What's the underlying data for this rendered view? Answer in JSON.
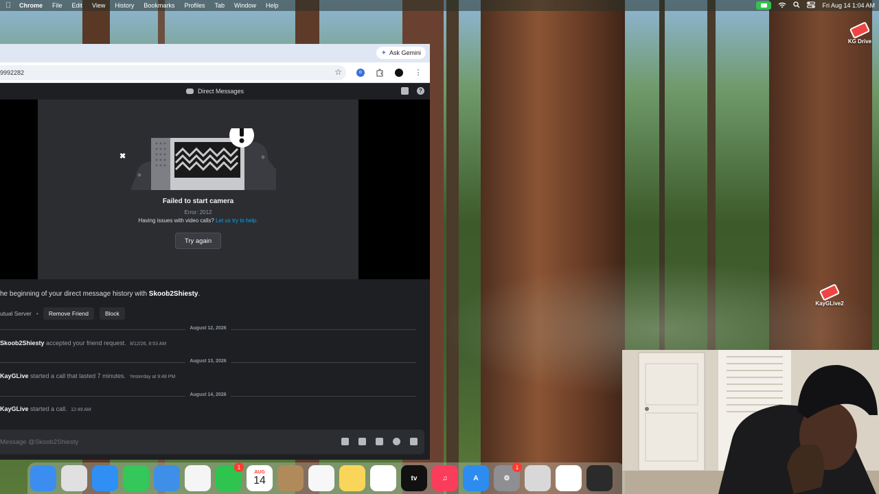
{
  "menubar": {
    "app_name": "Chrome",
    "items": [
      "File",
      "Edit",
      "View",
      "History",
      "Bookmarks",
      "Profiles",
      "Tab",
      "Window",
      "Help"
    ],
    "clock": "Fri Aug 14  1:04 AM"
  },
  "desktop": {
    "icons": [
      {
        "label": "KG Drive",
        "icon": "drive-icon"
      },
      {
        "label": "KayGLive2",
        "icon": "drive-icon"
      }
    ]
  },
  "browser": {
    "ask_gemini_label": "Ask Gemini",
    "url_text": "9992282"
  },
  "discord": {
    "header_title": "Direct Messages",
    "call": {
      "title": "Failed to start camera",
      "error": "Error: 2012",
      "help_text": "Having issues with video calls?",
      "help_link": "Let us try to help.",
      "try_again_label": "Try again"
    },
    "history": {
      "beginning_prefix": "he beginning of your direct message history with",
      "username": "Skoob2Shiesty",
      "mutual_server": "utual Server",
      "remove_friend_label": "Remove Friend",
      "block_label": "Block"
    },
    "messages": [
      {
        "date": "August 12, 2026",
        "author": "Skoob2Shiesty",
        "text": "accepted your friend request.",
        "time": "8/12/26, 8:53 AM"
      },
      {
        "date": "August 13, 2026",
        "author": "KayGLive",
        "text": "started a call that lasted 7 minutes.",
        "time": "Yesterday at 9:48 PM"
      },
      {
        "date": "August 14, 2026",
        "author": "KayGLive",
        "text": "started a call.",
        "time": "12:49 AM"
      }
    ],
    "composer_placeholder": "Message @Skoob2Shiesty"
  },
  "dock": {
    "apps": [
      {
        "name": "finder",
        "color": "#3b8ef0",
        "label": ""
      },
      {
        "name": "launchpad",
        "color": "#e0e0e0",
        "label": ""
      },
      {
        "name": "safari",
        "color": "#2f8ff5",
        "label": ""
      },
      {
        "name": "messages",
        "color": "#34c759",
        "label": ""
      },
      {
        "name": "mail",
        "color": "#3d8fe8",
        "label": ""
      },
      {
        "name": "photos",
        "color": "#f5f5f5",
        "label": ""
      },
      {
        "name": "facetime",
        "color": "#2ec44f",
        "label": "",
        "badge": "1"
      },
      {
        "name": "calendar",
        "color": "#ffffff",
        "label": "14",
        "top": "AUG"
      },
      {
        "name": "contacts",
        "color": "#b08a5a",
        "label": ""
      },
      {
        "name": "reminders",
        "color": "#f7f7f7",
        "label": ""
      },
      {
        "name": "notes",
        "color": "#f9d65a",
        "label": ""
      },
      {
        "name": "freeform",
        "color": "#ffffff",
        "label": ""
      },
      {
        "name": "tv",
        "color": "#111111",
        "label": "tv"
      },
      {
        "name": "music",
        "color": "#fa3d5a",
        "label": "♫"
      },
      {
        "name": "app-store",
        "color": "#2d8cf0",
        "label": "A"
      },
      {
        "name": "system-settings",
        "color": "#8e8e93",
        "label": "⚙",
        "badge": "1"
      },
      {
        "name": "iphone-mirroring",
        "color": "#d8d8d8",
        "label": ""
      },
      {
        "name": "chrome",
        "color": "#ffffff",
        "label": ""
      },
      {
        "name": "obs",
        "color": "#2b2b2b",
        "label": ""
      }
    ]
  }
}
